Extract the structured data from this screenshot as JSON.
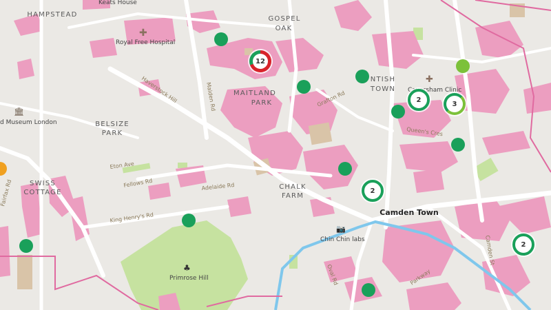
{
  "areas": {
    "hampstead": "HAMPSTEAD",
    "gospel_oak_1": "GOSPEL",
    "gospel_oak_2": "OAK",
    "kentish_1": "NTISH",
    "kentish_2": "TOWN",
    "maitland_1": "MAITLAND",
    "maitland_2": "PARK",
    "belsize_1": "BELSIZE",
    "belsize_2": "PARK",
    "swiss_1": "SWISS",
    "swiss_2": "COTTAGE",
    "chalk_1": "CHALK",
    "chalk_2": "FARM",
    "camden_town": "Camden Town"
  },
  "streets": {
    "haverstock": "Haverstock Hill",
    "eton": "Eton Ave",
    "fellows": "Fellows Rd",
    "adelaide": "Adelaide Rd",
    "king_henrys": "King Henry's Rd",
    "fairfax": "Fairfax Rd",
    "grafton": "Grafton Rd",
    "oval": "Oval Rd",
    "camden_st": "Camden St",
    "prince": "Parkway",
    "malden": "Malden Rd",
    "queens": "Queen's Cres"
  },
  "pois": {
    "keats": "Keats House",
    "royal_free": "Royal Free Hospital",
    "museum": "d Museum London",
    "caversham": "Caversham Clinic",
    "chin_chin": "Chin Chin labs",
    "primrose": "Primrose Hill"
  },
  "markers": {
    "cluster_main": "12",
    "cluster_kentish_a": "2",
    "cluster_kentish_b": "3",
    "cluster_chalk": "2",
    "cluster_camden": "2"
  },
  "colors": {
    "marker_green": "#1aa05a",
    "marker_red": "#d8232a",
    "marker_lime": "#7cc13a",
    "marker_orange": "#f0a020",
    "building_pink": "#ec9ec0",
    "park_green": "#c6e2a0",
    "water_blue": "#7fc7ec",
    "boundary_pink": "#e06aa0"
  }
}
